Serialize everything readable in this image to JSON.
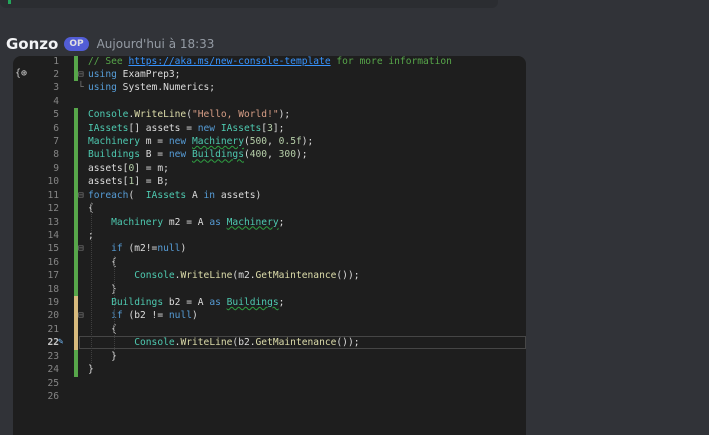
{
  "prev_message": {},
  "message": {
    "author": "Gonzo",
    "badge": "OP",
    "timestamp": "Aujourd'hui à 18:33"
  },
  "editor": {
    "gutter_icon": "{⊕",
    "active_line": 22,
    "lines": [
      {
        "n": "1",
        "bar": "green",
        "fold": "",
        "tokens": [
          {
            "t": "// See ",
            "c": "cm"
          },
          {
            "t": "https://aka.ms/new-console-template",
            "c": "lk"
          },
          {
            "t": " for more information",
            "c": "cm"
          }
        ]
      },
      {
        "n": "2",
        "bar": "green",
        "fold": "⊟",
        "tokens": [
          {
            "t": "using",
            "c": "kw"
          },
          {
            "t": " ExamPrep3;",
            "c": ""
          }
        ]
      },
      {
        "n": "3",
        "bar": "",
        "fold": "└",
        "tokens": [
          {
            "t": "using",
            "c": "kw"
          },
          {
            "t": " System.Numerics;",
            "c": ""
          }
        ]
      },
      {
        "n": "4",
        "bar": "",
        "fold": "",
        "tokens": []
      },
      {
        "n": "5",
        "bar": "green",
        "fold": "",
        "tokens": [
          {
            "t": "Console",
            "c": "ty"
          },
          {
            "t": ".",
            "c": ""
          },
          {
            "t": "WriteLine",
            "c": "me"
          },
          {
            "t": "(",
            "c": ""
          },
          {
            "t": "\"Hello, World!\"",
            "c": "st"
          },
          {
            "t": ");",
            "c": ""
          }
        ]
      },
      {
        "n": "6",
        "bar": "green",
        "fold": "",
        "tokens": [
          {
            "t": "IAssets",
            "c": "ty"
          },
          {
            "t": "[] assets = ",
            "c": ""
          },
          {
            "t": "new",
            "c": "kw"
          },
          {
            "t": " ",
            "c": ""
          },
          {
            "t": "IAssets",
            "c": "ty"
          },
          {
            "t": "[",
            "c": ""
          },
          {
            "t": "3",
            "c": "nu"
          },
          {
            "t": "];",
            "c": ""
          }
        ]
      },
      {
        "n": "7",
        "bar": "green",
        "fold": "",
        "tokens": [
          {
            "t": "Machinery",
            "c": "ty"
          },
          {
            "t": " m = ",
            "c": ""
          },
          {
            "t": "new",
            "c": "kw"
          },
          {
            "t": " ",
            "c": ""
          },
          {
            "t": "Machinery",
            "c": "ty sq"
          },
          {
            "t": "(",
            "c": ""
          },
          {
            "t": "500",
            "c": "nu"
          },
          {
            "t": ", ",
            "c": ""
          },
          {
            "t": "0.5f",
            "c": "nu"
          },
          {
            "t": ");",
            "c": ""
          }
        ]
      },
      {
        "n": "8",
        "bar": "green",
        "fold": "",
        "tokens": [
          {
            "t": "Buildings",
            "c": "ty"
          },
          {
            "t": " B = ",
            "c": ""
          },
          {
            "t": "new",
            "c": "kw"
          },
          {
            "t": " ",
            "c": ""
          },
          {
            "t": "Buildings",
            "c": "ty sq"
          },
          {
            "t": "(",
            "c": ""
          },
          {
            "t": "400",
            "c": "nu"
          },
          {
            "t": ", ",
            "c": ""
          },
          {
            "t": "300",
            "c": "nu"
          },
          {
            "t": ");",
            "c": ""
          }
        ]
      },
      {
        "n": "9",
        "bar": "green",
        "fold": "",
        "tokens": [
          {
            "t": "assets[",
            "c": ""
          },
          {
            "t": "0",
            "c": "nu"
          },
          {
            "t": "] = m;",
            "c": ""
          }
        ]
      },
      {
        "n": "10",
        "bar": "green",
        "fold": "",
        "tokens": [
          {
            "t": "assets[",
            "c": ""
          },
          {
            "t": "1",
            "c": "nu"
          },
          {
            "t": "] = B;",
            "c": ""
          }
        ]
      },
      {
        "n": "11",
        "bar": "green",
        "fold": "⊟",
        "tokens": [
          {
            "t": "foreach",
            "c": "kw"
          },
          {
            "t": "(  ",
            "c": ""
          },
          {
            "t": "IAssets",
            "c": "ty"
          },
          {
            "t": " A ",
            "c": ""
          },
          {
            "t": "in",
            "c": "kw"
          },
          {
            "t": " assets)",
            "c": ""
          }
        ]
      },
      {
        "n": "12",
        "bar": "green",
        "fold": "",
        "tokens": [
          {
            "t": "{",
            "c": ""
          }
        ]
      },
      {
        "n": "13",
        "bar": "green",
        "fold": "",
        "tokens": [
          {
            "t": "    ",
            "c": ""
          },
          {
            "t": "Machinery",
            "c": "ty"
          },
          {
            "t": " m2 = A ",
            "c": ""
          },
          {
            "t": "as",
            "c": "kw"
          },
          {
            "t": " ",
            "c": ""
          },
          {
            "t": "Machinery",
            "c": "ty sq"
          },
          {
            "t": ";",
            "c": ""
          }
        ]
      },
      {
        "n": "14",
        "bar": "green",
        "fold": "",
        "tokens": [
          {
            "t": ";",
            "c": ""
          }
        ]
      },
      {
        "n": "15",
        "bar": "green",
        "fold": "⊟",
        "tokens": [
          {
            "t": "    ",
            "c": ""
          },
          {
            "t": "if",
            "c": "kw"
          },
          {
            "t": " (m2!=",
            "c": ""
          },
          {
            "t": "null",
            "c": "kw"
          },
          {
            "t": ")",
            "c": ""
          }
        ]
      },
      {
        "n": "16",
        "bar": "green",
        "fold": "",
        "tokens": [
          {
            "t": "    {",
            "c": ""
          }
        ]
      },
      {
        "n": "17",
        "bar": "green",
        "fold": "",
        "tokens": [
          {
            "t": "        ",
            "c": ""
          },
          {
            "t": "Console",
            "c": "ty"
          },
          {
            "t": ".",
            "c": ""
          },
          {
            "t": "WriteLine",
            "c": "me"
          },
          {
            "t": "(m2.",
            "c": ""
          },
          {
            "t": "GetMaintenance",
            "c": "me"
          },
          {
            "t": "());",
            "c": ""
          }
        ]
      },
      {
        "n": "18",
        "bar": "green",
        "fold": "",
        "tokens": [
          {
            "t": "    }",
            "c": ""
          }
        ]
      },
      {
        "n": "19",
        "bar": "yellow",
        "fold": "",
        "tokens": [
          {
            "t": "    ",
            "c": ""
          },
          {
            "t": "Buildings",
            "c": "ty"
          },
          {
            "t": " b2 = A ",
            "c": ""
          },
          {
            "t": "as",
            "c": "kw"
          },
          {
            "t": " ",
            "c": ""
          },
          {
            "t": "Buildings",
            "c": "ty sq"
          },
          {
            "t": ";",
            "c": ""
          }
        ]
      },
      {
        "n": "20",
        "bar": "yellow",
        "fold": "⊟",
        "tokens": [
          {
            "t": "    ",
            "c": ""
          },
          {
            "t": "if",
            "c": "kw"
          },
          {
            "t": " (b2 != ",
            "c": ""
          },
          {
            "t": "null",
            "c": "kw"
          },
          {
            "t": ")",
            "c": ""
          }
        ]
      },
      {
        "n": "21",
        "bar": "yellow",
        "fold": "",
        "tokens": [
          {
            "t": "    {",
            "c": ""
          }
        ]
      },
      {
        "n": "22",
        "bar": "yellow",
        "fold": "",
        "tokens": [
          {
            "t": "        ",
            "c": ""
          },
          {
            "t": "Console",
            "c": "ty"
          },
          {
            "t": ".",
            "c": ""
          },
          {
            "t": "WriteLine",
            "c": "me"
          },
          {
            "t": "(b2.",
            "c": ""
          },
          {
            "t": "GetMaintenance",
            "c": "me"
          },
          {
            "t": "());",
            "c": ""
          }
        ]
      },
      {
        "n": "23",
        "bar": "green",
        "fold": "",
        "tokens": [
          {
            "t": "    }",
            "c": ""
          }
        ]
      },
      {
        "n": "24",
        "bar": "green",
        "fold": "",
        "tokens": [
          {
            "t": "}",
            "c": ""
          }
        ]
      },
      {
        "n": "25",
        "bar": "",
        "fold": "",
        "tokens": []
      },
      {
        "n": "26",
        "bar": "",
        "fold": "",
        "tokens": []
      }
    ]
  }
}
